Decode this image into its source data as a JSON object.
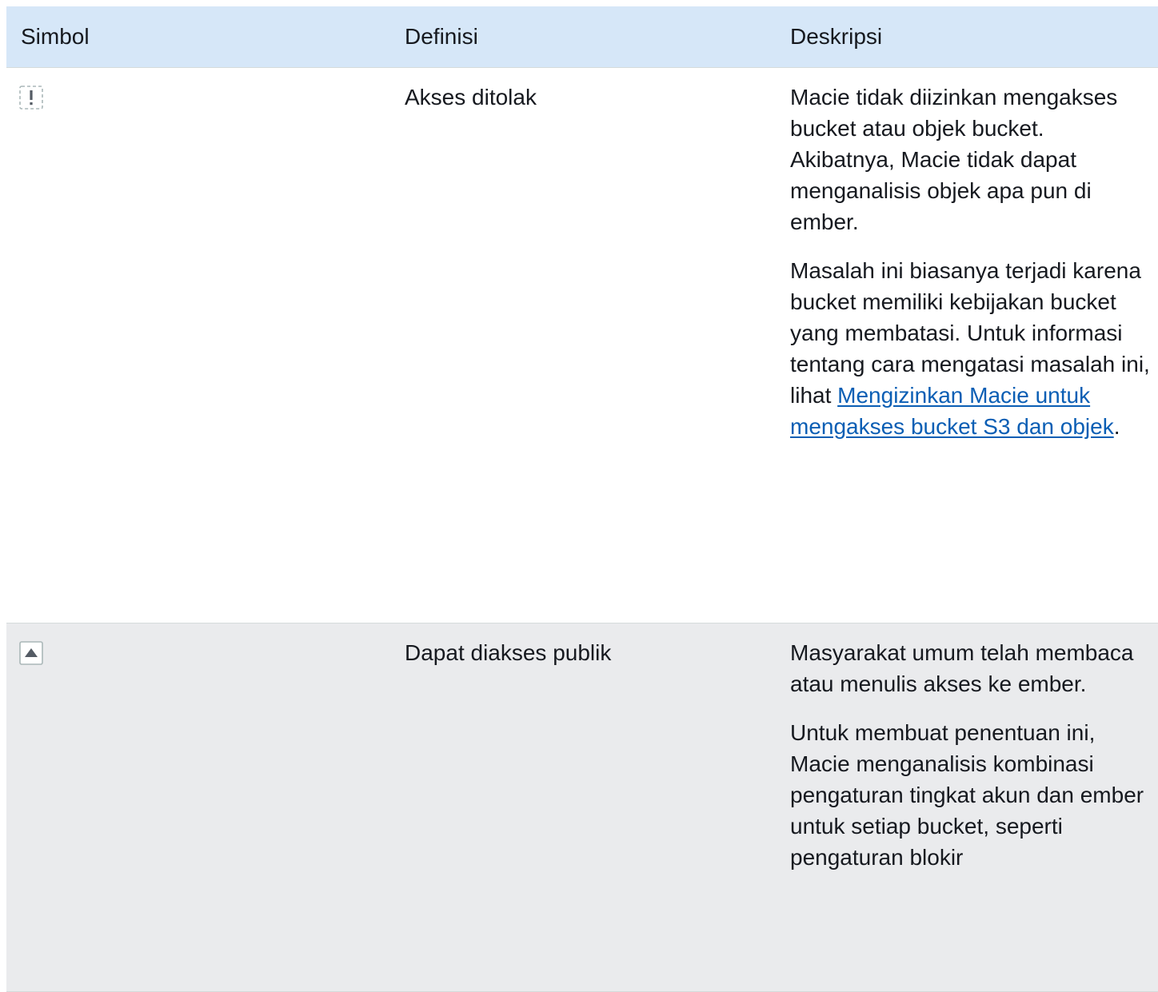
{
  "headers": [
    "Simbol",
    "Definisi",
    "Deskripsi"
  ],
  "rows": [
    {
      "icon": "access-denied-icon",
      "definition": "Akses ditolak",
      "desc1": "Macie tidak diizinkan mengakses bucket atau objek bucket. Akibatnya, Macie tidak dapat menganalisis objek apa pun di ember.",
      "desc2_before": "Masalah ini biasanya terjadi karena bucket memiliki kebijakan bucket yang membatasi. Untuk informasi tentang cara mengatasi masalah ini, lihat ",
      "desc2_link": "Mengizinkan Macie untuk mengakses bucket S3 dan objek",
      "desc2_after": "."
    },
    {
      "icon": "public-access-icon",
      "definition": "Dapat diakses publik",
      "desc1": "Masyarakat umum telah membaca atau menulis akses ke ember.",
      "desc2": "Untuk membuat penentuan ini, Macie menganalisis kombinasi pengaturan tingkat akun dan ember untuk setiap bucket, seperti pengaturan blokir"
    }
  ]
}
